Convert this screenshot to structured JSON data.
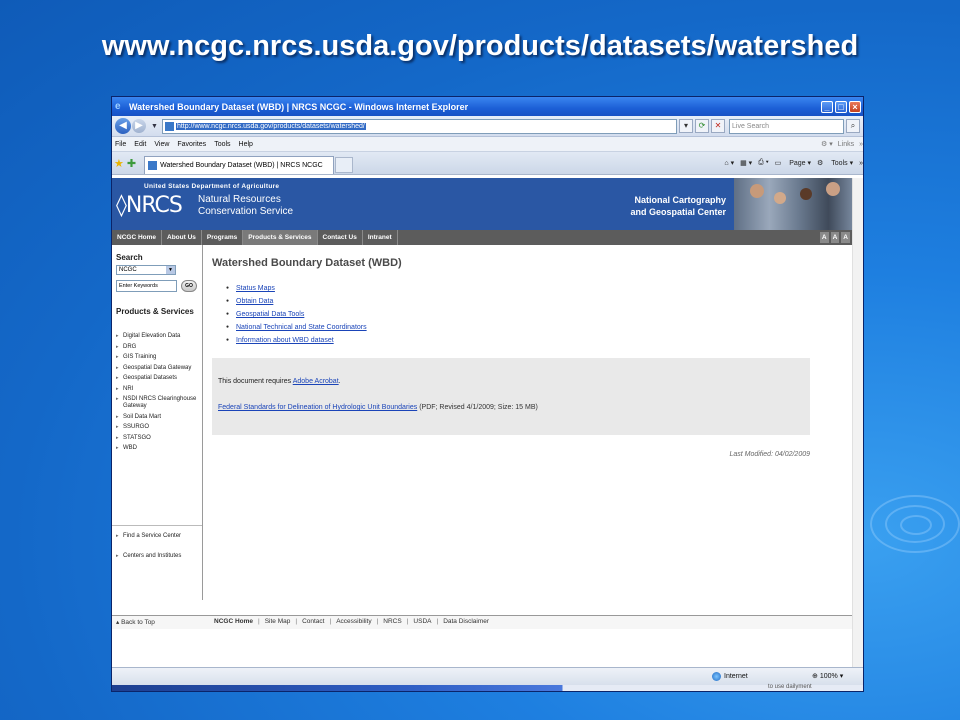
{
  "slide_title": "www.ncgc.nrcs.usda.gov/products/datasets/watershed",
  "window": {
    "title": "Watershed Boundary Dataset (WBD) | NRCS NCGC - Windows Internet Explorer",
    "url": "http://www.ncgc.nrcs.usda.gov/products/datasets/watershed/",
    "search_placeholder": "Live Search",
    "menu": [
      "File",
      "Edit",
      "View",
      "Favorites",
      "Tools",
      "Help"
    ],
    "links_label": "Links",
    "tab_title": "Watershed Boundary Dataset (WBD) | NRCS NCGC",
    "cmd_page": "Page",
    "cmd_tools": "Tools",
    "status_zone": "Internet",
    "zoom": "100%",
    "strip_hint": "to use dailyment"
  },
  "header": {
    "usda": "United States Department of Agriculture",
    "logo": "NRCS",
    "agency_line1": "Natural Resources",
    "agency_line2": "Conservation Service",
    "center_line1": "National Cartography",
    "center_line2": "and Geospatial Center"
  },
  "nav": {
    "items": [
      "NCGC Home",
      "About Us",
      "Programs",
      "Products & Services",
      "Contact Us",
      "Intranet"
    ],
    "text_sizes": [
      "A",
      "A",
      "A"
    ]
  },
  "sidebar": {
    "search_label": "Search",
    "search_scope": "NCGC",
    "keyword_placeholder": "Enter Keywords",
    "go_label": "GO",
    "section_title": "Products & Services",
    "items": [
      "Digital Elevation Data",
      "DRG",
      "GIS Training",
      "Geospatial Data Gateway",
      "Geospatial Datasets",
      "NRI",
      "NSDI NRCS Clearinghouse Gateway",
      "Soil Data Mart",
      "SSURGO",
      "STATSGO",
      "WBD"
    ],
    "bottom_items": [
      "Find a Service Center",
      "Centers and Institutes"
    ]
  },
  "main": {
    "title": "Watershed Boundary Dataset (WBD)",
    "links": [
      "Status Maps",
      "Obtain Data",
      "Geospatial Data Tools",
      "National Technical and State Coordinators",
      "Information about WBD dataset"
    ],
    "acrobat_prefix": "This document requires",
    "acrobat_link": "Adobe Acrobat",
    "acrobat_suffix": ".",
    "doc_link": "Federal Standards for Delineation of Hydrologic Unit Boundaries",
    "doc_meta": "(PDF; Revised 4/1/2009; Size: 15 MB)",
    "last_modified": "Last Modified: 04/02/2009"
  },
  "footer": {
    "back_to_top": "Back to Top",
    "links": [
      "NCGC Home",
      "Site Map",
      "Contact",
      "Accessibility",
      "NRCS",
      "USDA",
      "Data Disclaimer"
    ]
  }
}
